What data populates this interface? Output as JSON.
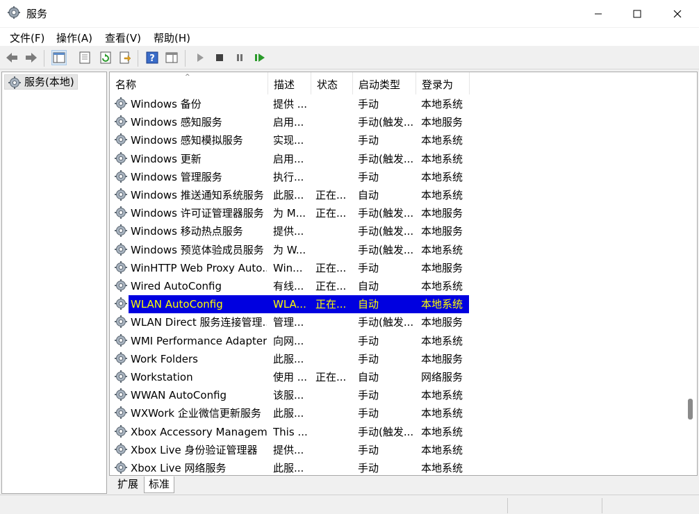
{
  "window": {
    "title": "服务"
  },
  "menu": [
    "文件(F)",
    "操作(A)",
    "查看(V)",
    "帮助(H)"
  ],
  "tree": {
    "root_label": "服务(本地)"
  },
  "columns": [
    "名称",
    "描述",
    "状态",
    "启动类型",
    "登录为"
  ],
  "rows": [
    [
      "Windows 备份",
      "提供 ...",
      "",
      "手动",
      "本地系统"
    ],
    [
      "Windows 感知服务",
      "启用...",
      "",
      "手动(触发...",
      "本地服务"
    ],
    [
      "Windows 感知模拟服务",
      "实现...",
      "",
      "手动",
      "本地系统"
    ],
    [
      "Windows 更新",
      "启用...",
      "",
      "手动(触发...",
      "本地系统"
    ],
    [
      "Windows 管理服务",
      "执行...",
      "",
      "手动",
      "本地系统"
    ],
    [
      "Windows 推送通知系统服务",
      "此服...",
      "正在...",
      "自动",
      "本地系统"
    ],
    [
      "Windows 许可证管理器服务",
      "为 M...",
      "正在...",
      "手动(触发...",
      "本地服务"
    ],
    [
      "Windows 移动热点服务",
      "提供...",
      "",
      "手动(触发...",
      "本地服务"
    ],
    [
      "Windows 预览体验成员服务",
      "为 W...",
      "",
      "手动(触发...",
      "本地系统"
    ],
    [
      "WinHTTP Web Proxy Auto...",
      "Win...",
      "正在...",
      "手动",
      "本地服务"
    ],
    [
      "Wired AutoConfig",
      "有线...",
      "正在...",
      "自动",
      "本地系统"
    ],
    [
      "WLAN AutoConfig",
      "WLA...",
      "正在...",
      "自动",
      "本地系统"
    ],
    [
      "WLAN Direct 服务连接管理...",
      "管理...",
      "",
      "手动(触发...",
      "本地服务"
    ],
    [
      "WMI Performance Adapter",
      "向网...",
      "",
      "手动",
      "本地系统"
    ],
    [
      "Work Folders",
      "此服...",
      "",
      "手动",
      "本地服务"
    ],
    [
      "Workstation",
      "使用 ...",
      "正在...",
      "自动",
      "网络服务"
    ],
    [
      "WWAN AutoConfig",
      "该服...",
      "",
      "手动",
      "本地系统"
    ],
    [
      "WXWork 企业微信更新服务",
      "此服...",
      "",
      "手动",
      "本地系统"
    ],
    [
      "Xbox Accessory Managem...",
      "This ...",
      "",
      "手动(触发...",
      "本地系统"
    ],
    [
      "Xbox Live 身份验证管理器",
      "提供...",
      "",
      "手动",
      "本地系统"
    ],
    [
      "Xbox Live 网络服务",
      "此服...",
      "",
      "手动",
      "本地系统"
    ]
  ],
  "selected_row": 11,
  "tabs": [
    "扩展",
    "标准"
  ],
  "colors": {
    "selection_bg": "#0000e0",
    "selection_text": "#ffff00"
  }
}
